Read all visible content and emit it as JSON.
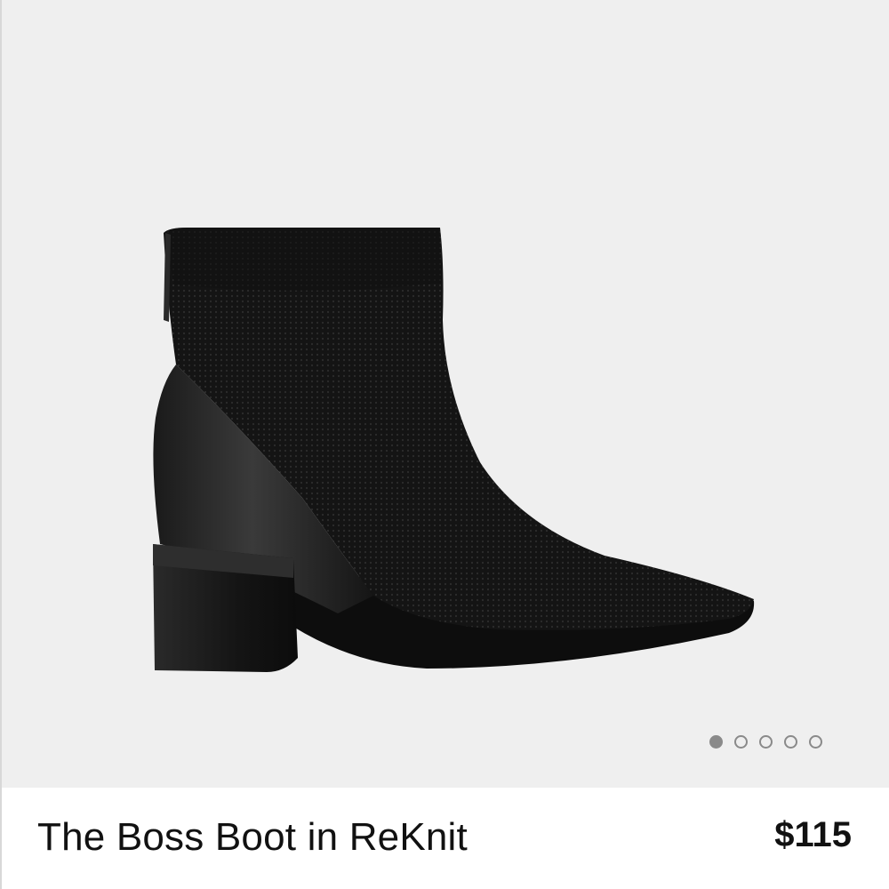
{
  "product": {
    "name": "The Boss Boot in ReKnit",
    "price": "$115",
    "image_alt": "The Boss Boot in ReKnit - black knit ankle boot with leather heel counter"
  },
  "carousel": {
    "total_slides": 5,
    "active_index": 0
  },
  "colors": {
    "image_background": "#efefef",
    "dot": "#8a8a8a",
    "text": "#111111"
  },
  "icons": {
    "carousel_dot": "circle-icon"
  }
}
